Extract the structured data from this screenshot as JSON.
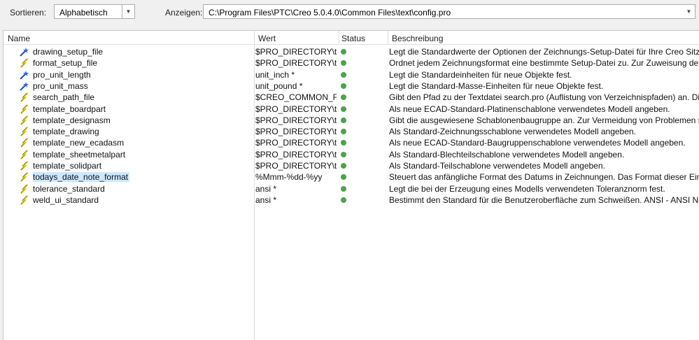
{
  "toolbar": {
    "sort_label": "Sortieren:",
    "sort_value": "Alphabetisch",
    "show_label": "Anzeigen:",
    "show_value": "C:\\Program Files\\PTC\\Creo 5.0.4.0\\Common Files\\text\\config.pro"
  },
  "columns": {
    "name": "Name",
    "wert": "Wert",
    "status": "Status",
    "desc": "Beschreibung"
  },
  "colors": {
    "status_ok": "#4fa04f",
    "selection": "#cce8ff"
  },
  "rows": [
    {
      "name": "drawing_setup_file",
      "wert": "$PRO_DIRECTORY\\text\\",
      "icon": "blue-star-icon",
      "desc": "Legt die Standardwerte der Optionen der Zeichnungs-Setup-Datei für Ihre Creo Sitzung fe"
    },
    {
      "name": "format_setup_file",
      "wert": "$PRO_DIRECTORY\\text\\",
      "icon": "lightning-icon",
      "desc": "Ordnet jedem Zeichnungsformat eine bestimmte Setup-Datei zu. Zur Zuweisung der Zeich"
    },
    {
      "name": "pro_unit_length",
      "wert": "unit_inch *",
      "icon": "blue-star-icon",
      "desc": "Legt die Standardeinheiten für neue Objekte fest."
    },
    {
      "name": "pro_unit_mass",
      "wert": "unit_pound *",
      "icon": "blue-star-icon",
      "desc": "Legt die Standard-Masse-Einheiten für neue Objekte fest."
    },
    {
      "name": "search_path_file",
      "wert": "$CREO_COMMON_FILES",
      "icon": "lightning-icon",
      "desc": "Gibt den Pfad zu der Textdatei search.pro (Auflistung von Verzeichnispfaden) an. Die in de"
    },
    {
      "name": "template_boardpart",
      "wert": "$PRO_DIRECTORY\\temp",
      "icon": "lightning-icon",
      "desc": "Als neue ECAD-Standard-Platinenschablone verwendetes Modell angeben."
    },
    {
      "name": "template_designasm",
      "wert": "$PRO_DIRECTORY\\temp",
      "icon": "lightning-icon",
      "desc": "Gibt die ausgewiesene Schablonenbaugruppe an. Zur Vermeidung von Problemen sollte c"
    },
    {
      "name": "template_drawing",
      "wert": "$PRO_DIRECTORY\\temp",
      "icon": "lightning-icon",
      "desc": "Als Standard-Zeichnungsschablone verwendetes Modell angeben."
    },
    {
      "name": "template_new_ecadasm",
      "wert": "$PRO_DIRECTORY\\temp",
      "icon": "lightning-icon",
      "desc": "Als neue ECAD-Standard-Baugruppenschablone verwendetes Modell angeben."
    },
    {
      "name": "template_sheetmetalpart",
      "wert": "$PRO_DIRECTORY\\temp",
      "icon": "lightning-icon",
      "desc": "Als Standard-Blechteilschablone verwendetes Modell angeben."
    },
    {
      "name": "template_solidpart",
      "wert": "$PRO_DIRECTORY\\temp",
      "icon": "lightning-icon",
      "desc": "Als Standard-Teilschablone verwendetes Modell angeben."
    },
    {
      "name": "todays_date_note_format",
      "wert": "%Mmm-%dd-%yy",
      "icon": "lightning-icon",
      "desc": "Steuert das anfängliche Format des Datums in Zeichnungen. Das Format dieser Einstellun",
      "selected": true
    },
    {
      "name": "tolerance_standard",
      "wert": "ansi *",
      "icon": "lightning-icon",
      "desc": "Legt die bei der Erzeugung eines Modells verwendeten Toleranznorm fest."
    },
    {
      "name": "weld_ui_standard",
      "wert": "ansi *",
      "icon": "lightning-icon",
      "desc": "Bestimmt den Standard für die Benutzeroberfläche zum Schweißen. ANSI - ANSI Normen"
    }
  ]
}
